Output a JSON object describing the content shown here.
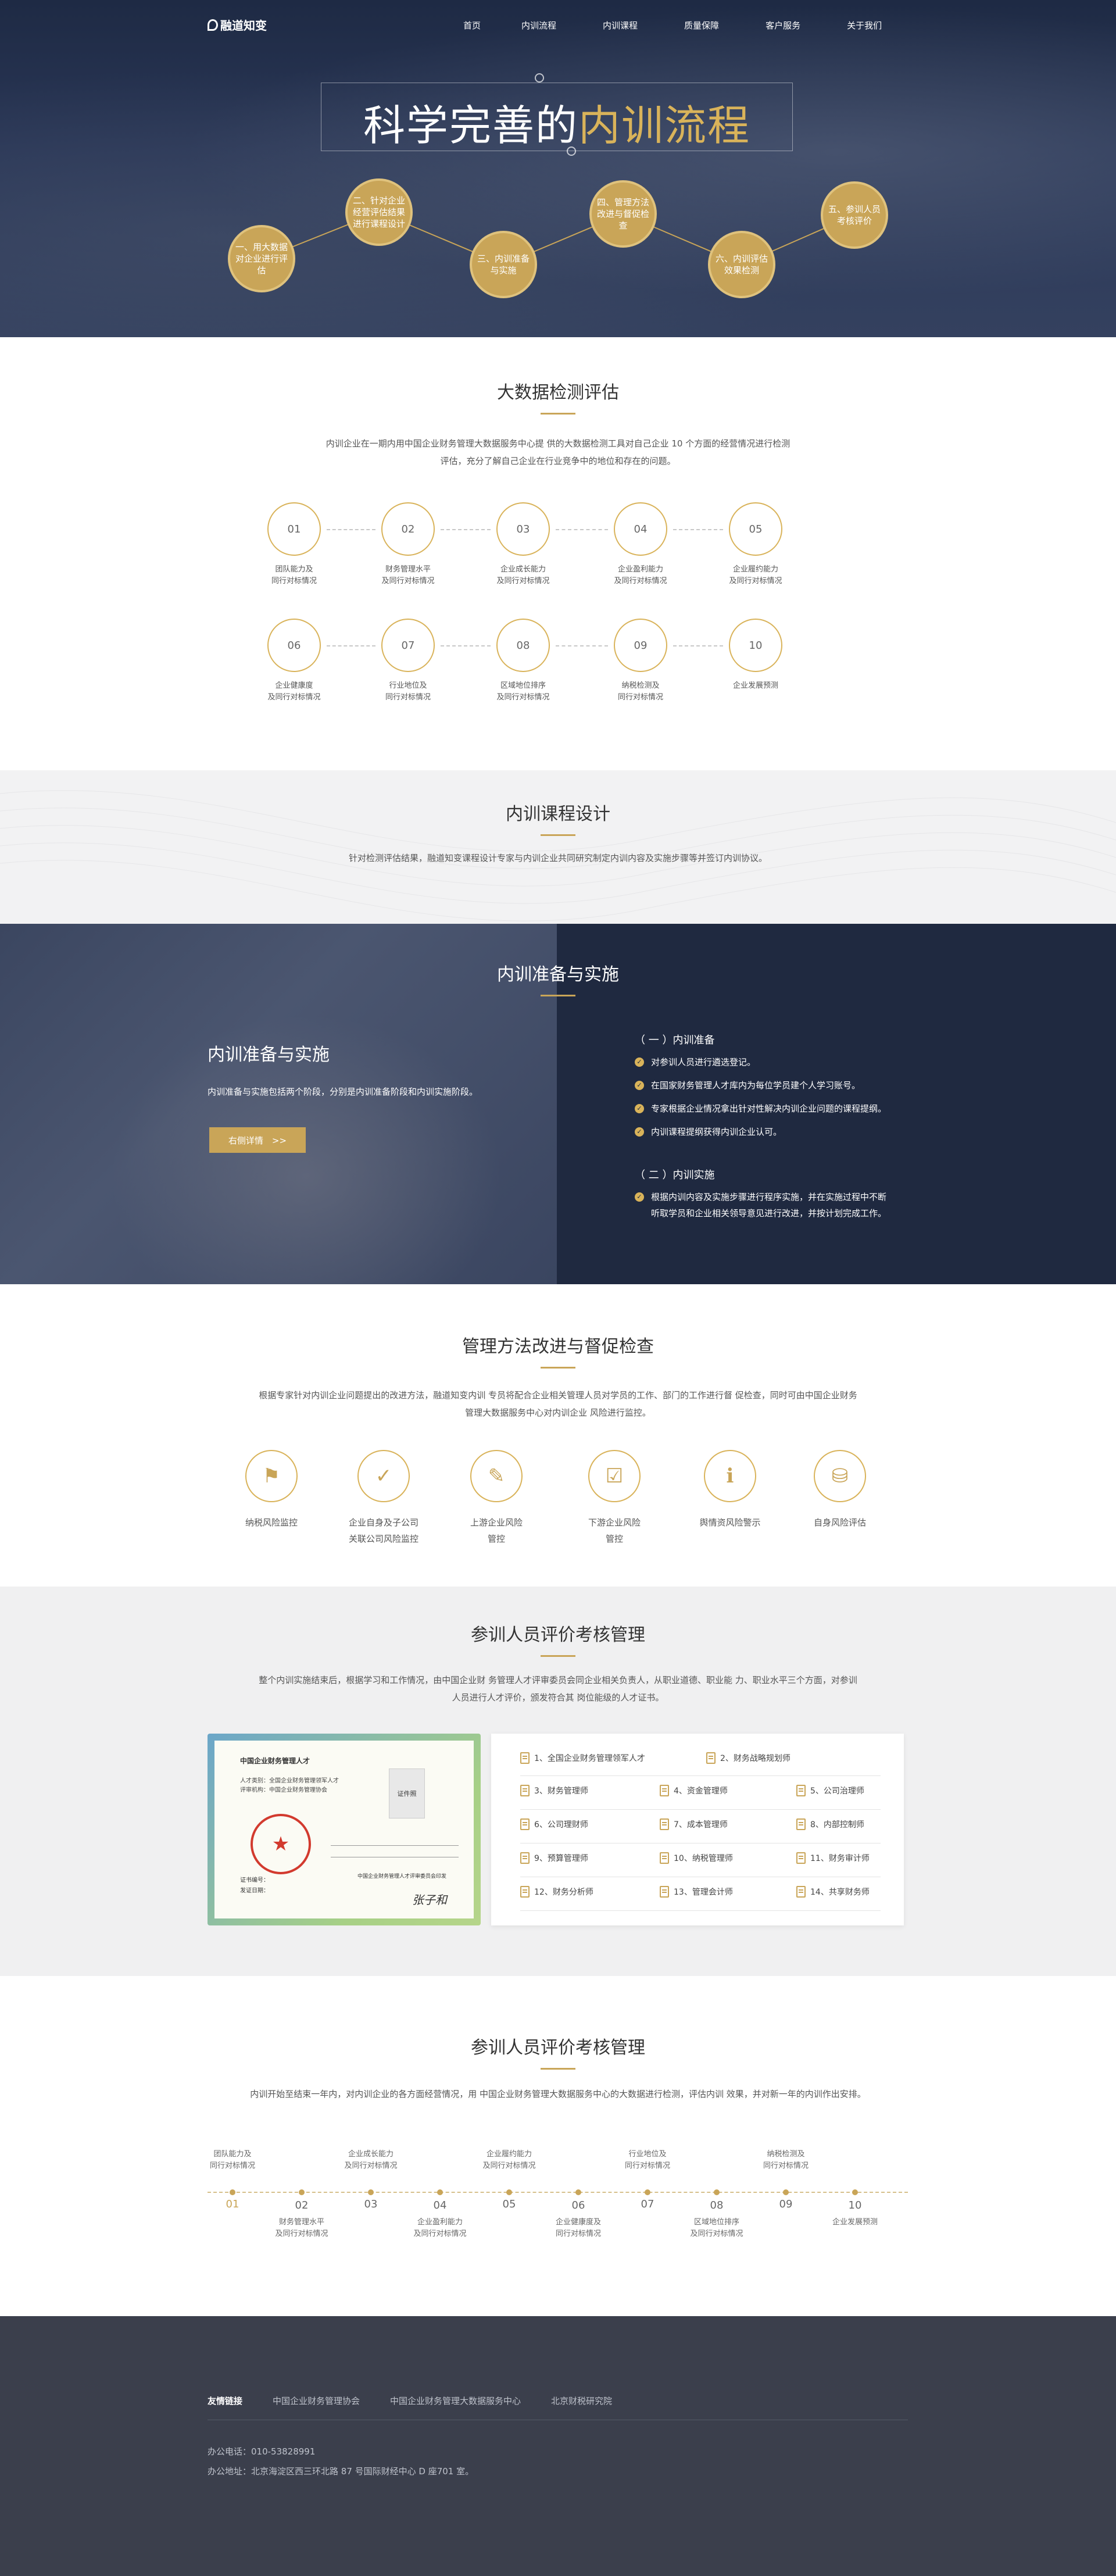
{
  "nav": {
    "logo": "融道知变",
    "items": [
      "首页",
      "内训流程",
      "内训课程",
      "质量保障",
      "客户服务",
      "关于我们"
    ]
  },
  "hero": {
    "title_white": "科学完善的",
    "title_gold": "内训流程",
    "steps": [
      "一、用大数据对企业进行评估",
      "二、针对企业经营评估结果进行课程设计",
      "三、内训准备与实施",
      "四、管理方法改进与督促检查",
      "六、内训评估效果检测",
      "五、参训人员考核评价"
    ]
  },
  "bigdata": {
    "title": "大数据检测评估",
    "desc_line1": "内训企业在一期内用中国企业财务管理大数据服务中心提 供的大数据检测工具对自己企业 10 个方面的经营情况进行检测",
    "desc_line2": "评估，充分了解自己企业在行业竞争中的地位和存在的问题。",
    "items": [
      {
        "num": "01",
        "l1": "团队能力及",
        "l2": "同行对标情况"
      },
      {
        "num": "02",
        "l1": "财务管理水平",
        "l2": "及同行对标情况"
      },
      {
        "num": "03",
        "l1": "企业成长能力",
        "l2": "及同行对标情况"
      },
      {
        "num": "04",
        "l1": "企业盈利能力",
        "l2": "及同行对标情况"
      },
      {
        "num": "05",
        "l1": "企业履约能力",
        "l2": "及同行对标情况"
      },
      {
        "num": "06",
        "l1": "企业健康度",
        "l2": "及同行对标情况"
      },
      {
        "num": "07",
        "l1": "行业地位及",
        "l2": "同行对标情况"
      },
      {
        "num": "08",
        "l1": "区域地位排序",
        "l2": "及同行对标情况"
      },
      {
        "num": "09",
        "l1": "纳税检测及",
        "l2": "同行对标情况"
      },
      {
        "num": "10",
        "l1": "企业发展预测",
        "l2": ""
      }
    ]
  },
  "course": {
    "title": "内训课程设计",
    "desc": "针对检测评估结果，融道知变课程设计专家与内训企业共同研究制定内训内容及实施步骤等并签订内训协议。"
  },
  "prep": {
    "section_title": "内训准备与实施",
    "left_title": "内训准备与实施",
    "left_desc": "内训准备与实施包括两个阶段，分别是内训准备阶段和内训实施阶段。",
    "button": "右侧详情　>>",
    "part1_title": "（ 一 ）内训准备",
    "part1_items": [
      "对参训人员进行遴选登记。",
      "在国家财务管理人才库内为每位学员建个人学习账号。",
      "专家根据企业情况拿出针对性解决内训企业问题的课程提纲。",
      "内训课程提纲获得内训企业认可。"
    ],
    "part2_title": "（ 二 ）内训实施",
    "part2_line1": "根据内训内容及实施步骤进行程序实施，并在实施过程中不断",
    "part2_line2": "听取学员和企业相关领导意见进行改进，并按计划完成工作。"
  },
  "mgmt": {
    "title": "管理方法改进与督促检查",
    "desc_line1": "根据专家针对内训企业问题提出的改进方法，融道知变内训 专员将配合企业相关管理人员对学员的工作、部门的工作进行督 促检查，同时可由中国企业财务",
    "desc_line2": "管理大数据服务中心对内训企业 风险进行监控。",
    "items": [
      {
        "icon": "map-icon",
        "l1": "纳税风险监控",
        "l2": ""
      },
      {
        "icon": "shield-icon",
        "l1": "企业自身及子公司",
        "l2": "关联公司风险监控"
      },
      {
        "icon": "doc-edit-icon",
        "l1": "上游企业风险",
        "l2": "管控"
      },
      {
        "icon": "doc-check-icon",
        "l1": "下游企业风险",
        "l2": "管控"
      },
      {
        "icon": "info-icon",
        "l1": "舆情资风险警示",
        "l2": ""
      },
      {
        "icon": "database-icon",
        "l1": "自身风险评估",
        "l2": ""
      }
    ]
  },
  "eval": {
    "title": "参训人员评价考核管理",
    "desc_line1": "整个内训实施结束后，根据学习和工作情况，由中国企业财 务管理人才评审委员会同企业相关负责人，从职业道德、职业能 力、职业水平三个方面，对参训",
    "desc_line2": "人员进行人才评价，颁发符合其 岗位能级的人才证书。",
    "cert": {
      "heading": "中国企业财务管理人才",
      "photo": "证件照",
      "lines": [
        "人才类别：全国企业财务管理领军人才",
        "评审机构：中国企业财务管理协会"
      ],
      "seal": "中国企业财务管理协会",
      "foot1": "证书编号：",
      "foot2": "发证日期：",
      "org": "中国企业财务管理人才评审委员会印发",
      "sign": "张子和"
    },
    "row1": [
      "1、全国企业财务管理领军人才",
      "2、财务战略规划师"
    ],
    "grid": [
      "3、财务管理师",
      "4、资金管理师",
      "5、公司治理师",
      "6、公司理财师",
      "7、成本管理师",
      "8、内部控制师",
      "9、预算管理师",
      "10、纳税管理师",
      "11、财务审计师",
      "12、财务分析师",
      "13、管理会计师",
      "14、共享财务师"
    ]
  },
  "timeline": {
    "title": "参训人员评价考核管理",
    "desc": "内训开始至结束一年内，对内训企业的各方面经营情况，用 中国企业财务管理大数据服务中心的大数据进行检测，评估内训 效果，并对新一年的内训作出安排。",
    "nums": [
      "01",
      "02",
      "03",
      "04",
      "05",
      "06",
      "07",
      "08",
      "09",
      "10"
    ],
    "top": [
      {
        "l1": "团队能力及",
        "l2": "同行对标情况"
      },
      {
        "l1": "企业成长能力",
        "l2": "及同行对标情况"
      },
      {
        "l1": "企业履约能力",
        "l2": "及同行对标情况"
      },
      {
        "l1": "行业地位及",
        "l2": "同行对标情况"
      },
      {
        "l1": "纳税检测及",
        "l2": "同行对标情况"
      }
    ],
    "bottom": [
      {
        "l1": "财务管理水平",
        "l2": "及同行对标情况"
      },
      {
        "l1": "企业盈利能力",
        "l2": "及同行对标情况"
      },
      {
        "l1": "企业健康度及",
        "l2": "同行对标情况"
      },
      {
        "l1": "区域地位排序",
        "l2": "及同行对标情况"
      },
      {
        "l1": "企业发展预测",
        "l2": ""
      }
    ]
  },
  "footer": {
    "links_label": "友情链接",
    "links": [
      "中国企业财务管理协会",
      "中国企业财务管理大数据服务中心",
      "北京财税研究院"
    ],
    "phone": "办公电话：010-53828991",
    "address": "办公地址：北京海淀区西三环北路 87 号国际财经中心 D 座701 室。"
  },
  "colors": {
    "gold": "#c9a558",
    "navy": "#1f2940",
    "footer": "#3b3f4c"
  }
}
